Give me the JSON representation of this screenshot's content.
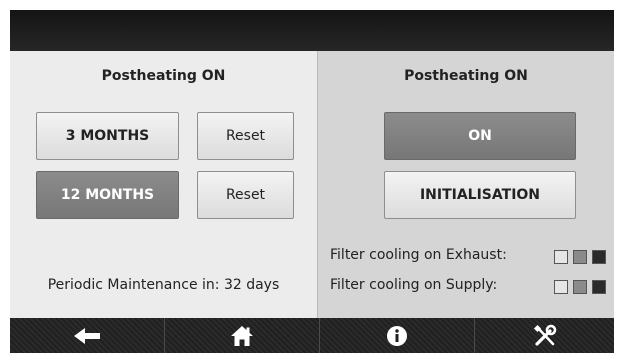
{
  "left_panel": {
    "title": "Postheating ON",
    "buttons": {
      "three_months": "3 MONTHS",
      "twelve_months": "12 MONTHS",
      "reset_1": "Reset",
      "reset_2": "Reset"
    },
    "maintenance_text": "Periodic Maintenance in: 32 days"
  },
  "right_panel": {
    "title": "Postheating ON",
    "buttons": {
      "on": "ON",
      "initialisation": "INITIALISATION"
    },
    "filters": [
      {
        "label": "Filter cooling on Exhaust:",
        "swatches": [
          "#e6e6e6",
          "#8a8a8a",
          "#2a2a2a"
        ]
      },
      {
        "label": "Filter cooling on Supply:",
        "swatches": [
          "#e6e6e6",
          "#8a8a8a",
          "#2a2a2a"
        ]
      }
    ]
  },
  "bottom_nav": {
    "items": [
      {
        "name": "back",
        "icon": "arrow-left-icon"
      },
      {
        "name": "home",
        "icon": "home-icon"
      },
      {
        "name": "info",
        "icon": "info-icon"
      },
      {
        "name": "settings",
        "icon": "tools-icon"
      }
    ]
  }
}
